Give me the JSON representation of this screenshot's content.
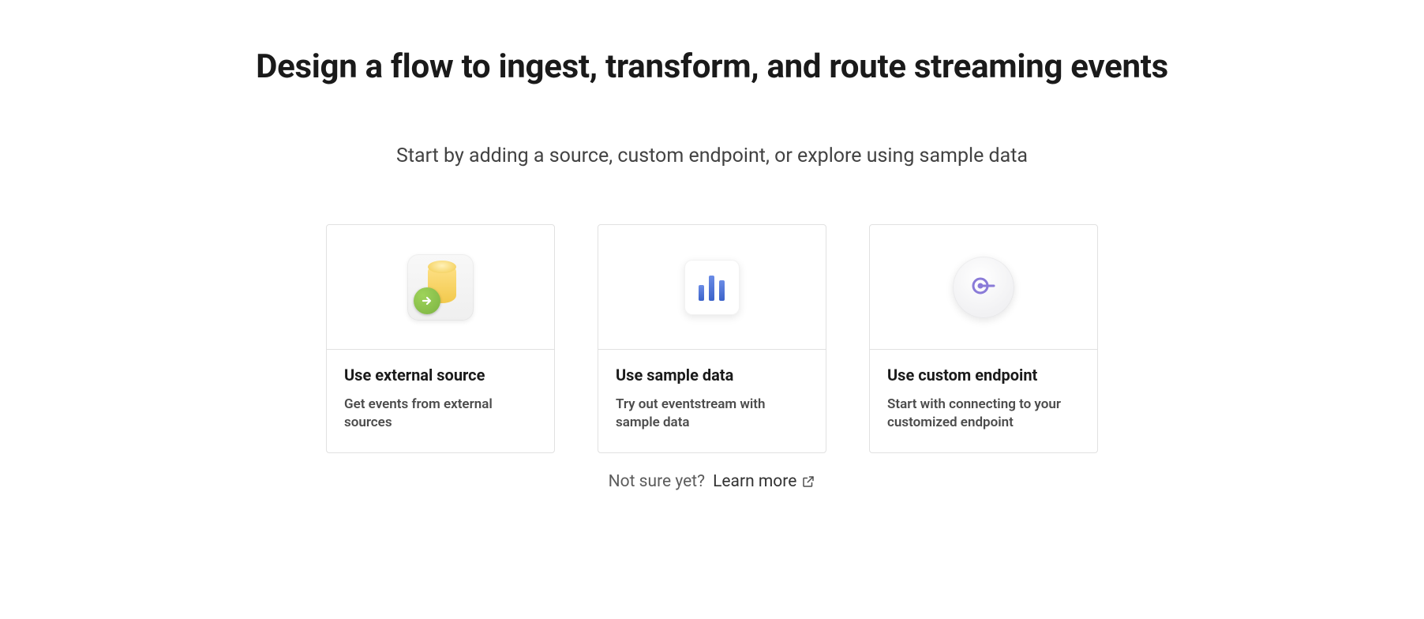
{
  "header": {
    "title": "Design a flow to ingest, transform, and route streaming events",
    "subtitle": "Start by adding a source, custom endpoint, or explore using sample data"
  },
  "cards": [
    {
      "title": "Use external source",
      "description": "Get events from external sources",
      "icon": "database-arrow-icon"
    },
    {
      "title": "Use sample data",
      "description": "Try out eventstream with sample data",
      "icon": "bar-chart-icon"
    },
    {
      "title": "Use custom endpoint",
      "description": "Start with connecting to your customized endpoint",
      "icon": "endpoint-icon"
    }
  ],
  "footer": {
    "prompt": "Not sure yet?",
    "learn_more": "Learn more"
  }
}
